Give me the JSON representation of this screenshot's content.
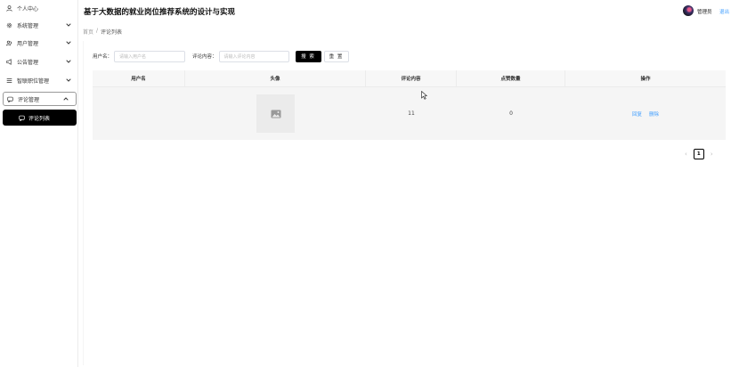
{
  "app": {
    "title": "基于大数据的就业岗位推荐系统的设计与实现"
  },
  "header": {
    "user_name": "管理员",
    "logout": "退出"
  },
  "sidebar": {
    "items": [
      {
        "label": "个人中心",
        "icon": "user-icon"
      },
      {
        "label": "系统管理",
        "icon": "gear-icon"
      },
      {
        "label": "用户管理",
        "icon": "users-icon"
      },
      {
        "label": "公告管理",
        "icon": "megaphone-icon"
      },
      {
        "label": "智联职位管理",
        "icon": "list-icon"
      },
      {
        "label": "评论管理",
        "icon": "comment-icon"
      }
    ],
    "active_sub": "评论列表"
  },
  "breadcrumb": {
    "home": "首页",
    "sep": "/",
    "current": "评论列表"
  },
  "search": {
    "username_label": "用户名：",
    "username_placeholder": "请输入用户名",
    "content_label": "评论内容：",
    "content_placeholder": "请输入评论内容",
    "search_btn": "搜 索",
    "reset_btn": "重 置"
  },
  "table": {
    "headers": [
      "用户名",
      "头像",
      "评论内容",
      "点赞数量",
      "操作"
    ],
    "rows": [
      {
        "username": "",
        "content": "11",
        "likes": "0",
        "actions": [
          "回复",
          "删除"
        ]
      }
    ]
  },
  "pagination": {
    "current": "1",
    "prev": "‹",
    "next": "›"
  },
  "colors": {
    "accent": "#409eff",
    "primary_btn": "#000000",
    "active_menu": "#000000"
  }
}
